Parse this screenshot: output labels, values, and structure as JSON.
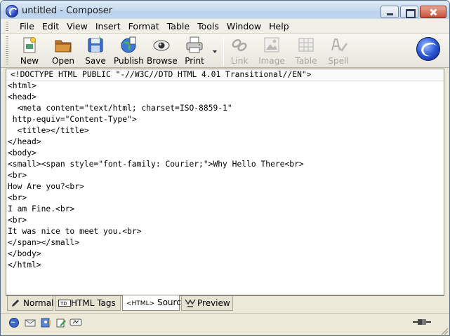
{
  "window": {
    "title": "untitled - Composer"
  },
  "menubar": {
    "items": [
      "File",
      "Edit",
      "View",
      "Insert",
      "Format",
      "Table",
      "Tools",
      "Window",
      "Help"
    ]
  },
  "toolbar": {
    "buttons": [
      {
        "label": "New",
        "icon": "new-document-icon",
        "enabled": true
      },
      {
        "label": "Open",
        "icon": "folder-icon",
        "enabled": true
      },
      {
        "label": "Save",
        "icon": "save-icon",
        "enabled": true
      },
      {
        "label": "Publish",
        "icon": "publish-globe-icon",
        "enabled": true
      },
      {
        "label": "Browse",
        "icon": "browse-eye-icon",
        "enabled": true
      },
      {
        "label": "Print",
        "icon": "printer-icon",
        "enabled": true
      },
      {
        "label": "Link",
        "icon": "link-icon",
        "enabled": false
      },
      {
        "label": "Image",
        "icon": "image-icon",
        "enabled": false
      },
      {
        "label": "Table",
        "icon": "table-icon",
        "enabled": false
      },
      {
        "label": "Spell",
        "icon": "spellcheck-icon",
        "enabled": false
      }
    ]
  },
  "editor": {
    "lines": [
      "<!DOCTYPE HTML PUBLIC \"-//W3C//DTD HTML 4.01 Transitional//EN\">",
      "<html>",
      "<head>",
      "  <meta content=\"text/html; charset=ISO-8859-1\"",
      " http-equiv=\"Content-Type\">",
      "  <title></title>",
      "</head>",
      "<body>",
      "<small><span style=\"font-family: Courier;\">Why Hello There<br>",
      "<br>",
      "How Are you?<br>",
      "<br>",
      "I am Fine.<br>",
      "<br>",
      "It was nice to meet you.<br>",
      "</span></small>",
      "</body>",
      "</html>"
    ]
  },
  "tabs": {
    "items": [
      {
        "label": "Normal",
        "icon": "pencil-icon",
        "active": false
      },
      {
        "label": "HTML Tags",
        "icon": "td-tag-icon",
        "active": false
      },
      {
        "label": "Source",
        "icon": "html-source-icon",
        "icon_text": "<HTML>",
        "active": true
      },
      {
        "label": "Preview",
        "icon": "preview-icon",
        "active": false
      }
    ]
  },
  "statusbar": {
    "icons": [
      "navigator-icon",
      "mail-icon",
      "address-book-icon",
      "composer-icon",
      "chat-icon"
    ],
    "right_icon": "online-connection-icon"
  },
  "colors": {
    "chrome": "#ece9d8",
    "titlebar": "#c8dbef",
    "editor_bg": "#ffffff"
  }
}
